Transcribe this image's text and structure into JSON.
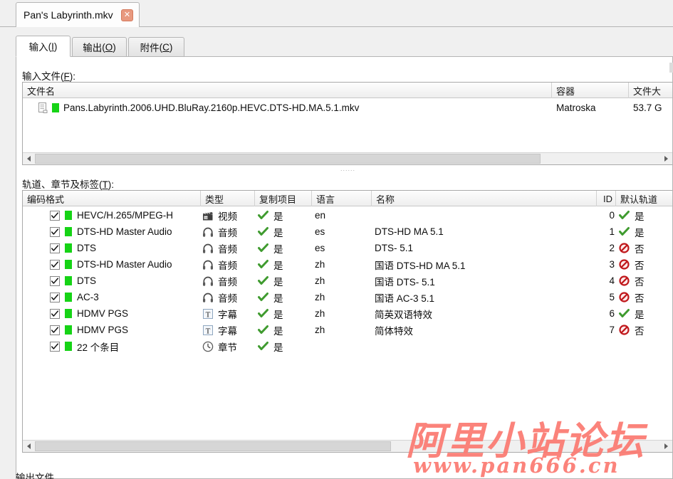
{
  "window": {
    "document_tab_label": "Pan's Labyrinth.mkv",
    "close_icon": "close-icon"
  },
  "tabs": [
    {
      "label_main": "输入",
      "label_key": "I",
      "active": true
    },
    {
      "label_main": "输出",
      "label_key": "O",
      "active": false
    },
    {
      "label_main": "附件",
      "label_key": "C",
      "active": false
    }
  ],
  "input_files": {
    "section_label_main": "输入文件",
    "section_label_key": "F",
    "columns": [
      "文件名",
      "容器",
      "文件大"
    ],
    "rows": [
      {
        "filename": "Pans.Labyrinth.2006.UHD.BluRay.2160p.HEVC.DTS-HD.MA.5.1.mkv",
        "container": "Matroska",
        "size": "53.7 G"
      }
    ]
  },
  "tracks": {
    "section_label_main": "轨道、章节及标签",
    "section_label_key": "T",
    "columns": [
      "编码格式",
      "类型",
      "复制项目",
      "语言",
      "名称",
      "ID",
      "默认轨道"
    ],
    "rows": [
      {
        "checked": true,
        "codec": "HEVC/H.265/MPEG-H",
        "type_icon": "video-icon",
        "type": "视频",
        "copy": "是",
        "copy_icon": "check-icon",
        "language": "en",
        "name": "",
        "id": "0",
        "default": "是",
        "default_icon": "check-icon"
      },
      {
        "checked": true,
        "codec": "DTS-HD Master Audio",
        "type_icon": "audio-icon",
        "type": "音频",
        "copy": "是",
        "copy_icon": "check-icon",
        "language": "es",
        "name": "DTS-HD MA 5.1",
        "id": "1",
        "default": "是",
        "default_icon": "check-icon"
      },
      {
        "checked": true,
        "codec": "DTS",
        "type_icon": "audio-icon",
        "type": "音频",
        "copy": "是",
        "copy_icon": "check-icon",
        "language": "es",
        "name": "DTS- 5.1",
        "id": "2",
        "default": "否",
        "default_icon": "forbidden-icon"
      },
      {
        "checked": true,
        "codec": "DTS-HD Master Audio",
        "type_icon": "audio-icon",
        "type": "音频",
        "copy": "是",
        "copy_icon": "check-icon",
        "language": "zh",
        "name": "国语 DTS-HD MA 5.1",
        "id": "3",
        "default": "否",
        "default_icon": "forbidden-icon"
      },
      {
        "checked": true,
        "codec": "DTS",
        "type_icon": "audio-icon",
        "type": "音频",
        "copy": "是",
        "copy_icon": "check-icon",
        "language": "zh",
        "name": "国语 DTS- 5.1",
        "id": "4",
        "default": "否",
        "default_icon": "forbidden-icon"
      },
      {
        "checked": true,
        "codec": "AC-3",
        "type_icon": "audio-icon",
        "type": "音频",
        "copy": "是",
        "copy_icon": "check-icon",
        "language": "zh",
        "name": "国语 AC-3 5.1",
        "id": "5",
        "default": "否",
        "default_icon": "forbidden-icon"
      },
      {
        "checked": true,
        "codec": "HDMV PGS",
        "type_icon": "subtitle-icon",
        "type": "字幕",
        "copy": "是",
        "copy_icon": "check-icon",
        "language": "zh",
        "name": "简英双语特效",
        "id": "6",
        "default": "是",
        "default_icon": "check-icon"
      },
      {
        "checked": true,
        "codec": "HDMV PGS",
        "type_icon": "subtitle-icon",
        "type": "字幕",
        "copy": "是",
        "copy_icon": "check-icon",
        "language": "zh",
        "name": "简体特效",
        "id": "7",
        "default": "否",
        "default_icon": "forbidden-icon"
      },
      {
        "checked": true,
        "codec": "22 个条目",
        "type_icon": "chapter-icon",
        "type": "章节",
        "copy": "是",
        "copy_icon": "check-icon",
        "language": "",
        "name": "",
        "id": "",
        "default": "",
        "default_icon": ""
      }
    ]
  },
  "output_section_label": "输出文件",
  "watermark": {
    "text_cn": "阿里小站论坛",
    "text_url": "www.pan666.cn",
    "color": "#fb7a72"
  },
  "colors": {
    "green_flag": "#16d316",
    "check_green": "#3f9b2f",
    "forbidden_red": "#c0181c",
    "tab_close": "#e8997f"
  }
}
